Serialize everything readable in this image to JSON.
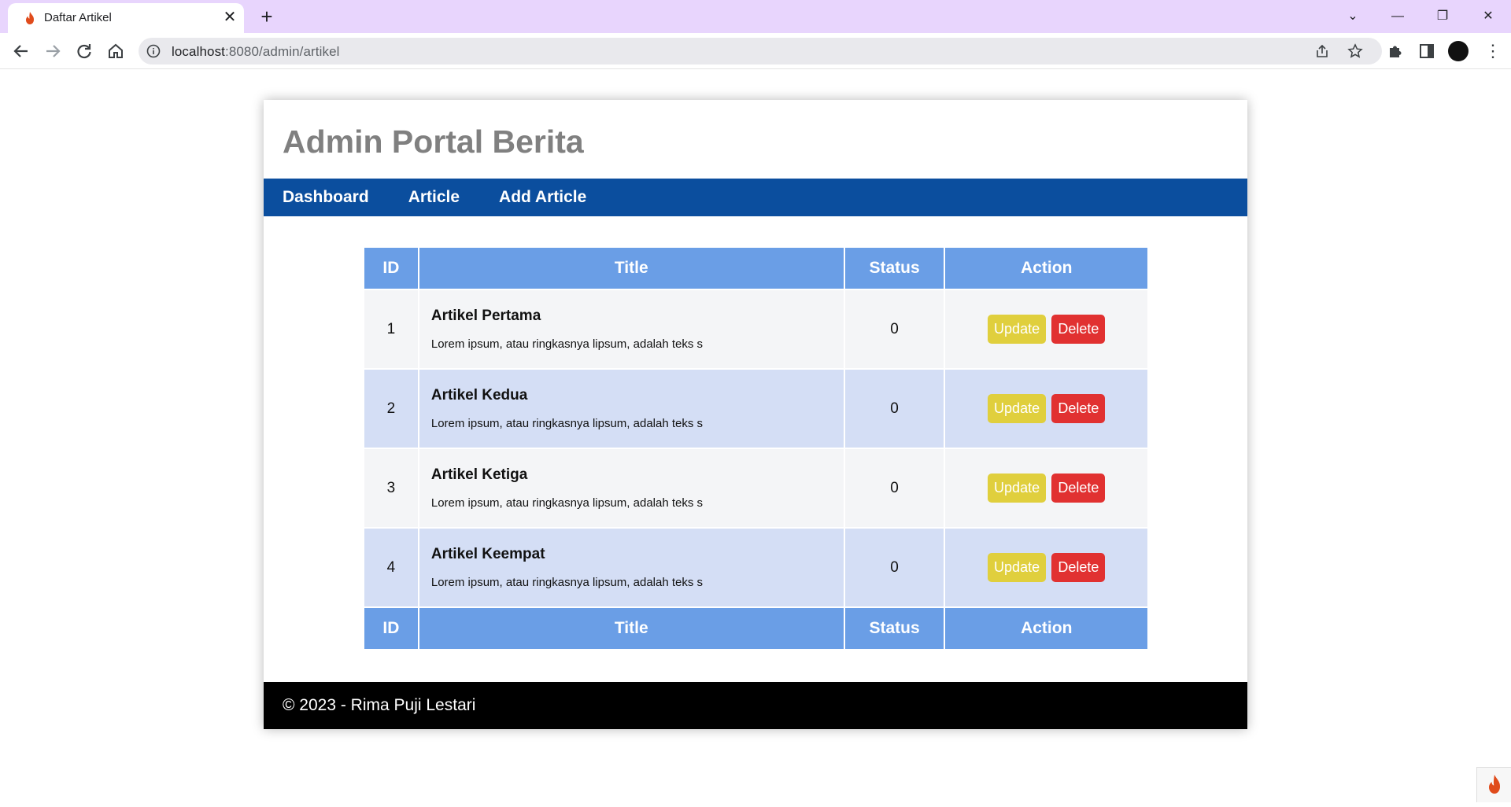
{
  "browser": {
    "tab_title": "Daftar Artikel",
    "tab_close": "✕",
    "new_tab": "+",
    "url_host": "localhost",
    "url_rest": ":8080/admin/artikel",
    "window_controls": [
      "⌄",
      "—",
      "❐",
      "✕"
    ],
    "menu": "⋮"
  },
  "site": {
    "title": "Admin Portal Berita",
    "nav": [
      "Dashboard",
      "Article",
      "Add Article"
    ]
  },
  "table": {
    "headers": [
      "ID",
      "Title",
      "Status",
      "Action"
    ],
    "rows": [
      {
        "id": "1",
        "title": "Artikel Pertama",
        "excerpt": "Lorem ipsum, atau ringkasnya lipsum, adalah teks s",
        "status": "0"
      },
      {
        "id": "2",
        "title": "Artikel Kedua",
        "excerpt": "Lorem ipsum, atau ringkasnya lipsum, adalah teks s",
        "status": "0"
      },
      {
        "id": "3",
        "title": "Artikel Ketiga",
        "excerpt": "Lorem ipsum, atau ringkasnya lipsum, adalah teks s",
        "status": "0"
      },
      {
        "id": "4",
        "title": "Artikel Keempat",
        "excerpt": "Lorem ipsum, atau ringkasnya lipsum, adalah teks s",
        "status": "0"
      }
    ],
    "update_label": "Update",
    "delete_label": "Delete"
  },
  "footer": {
    "text": "© 2023 - Rima Puji Lestari"
  },
  "colors": {
    "nav_bg": "#0b4e9e",
    "table_header": "#6a9ee6",
    "update": "#e0cf3d",
    "delete": "#e13131"
  }
}
